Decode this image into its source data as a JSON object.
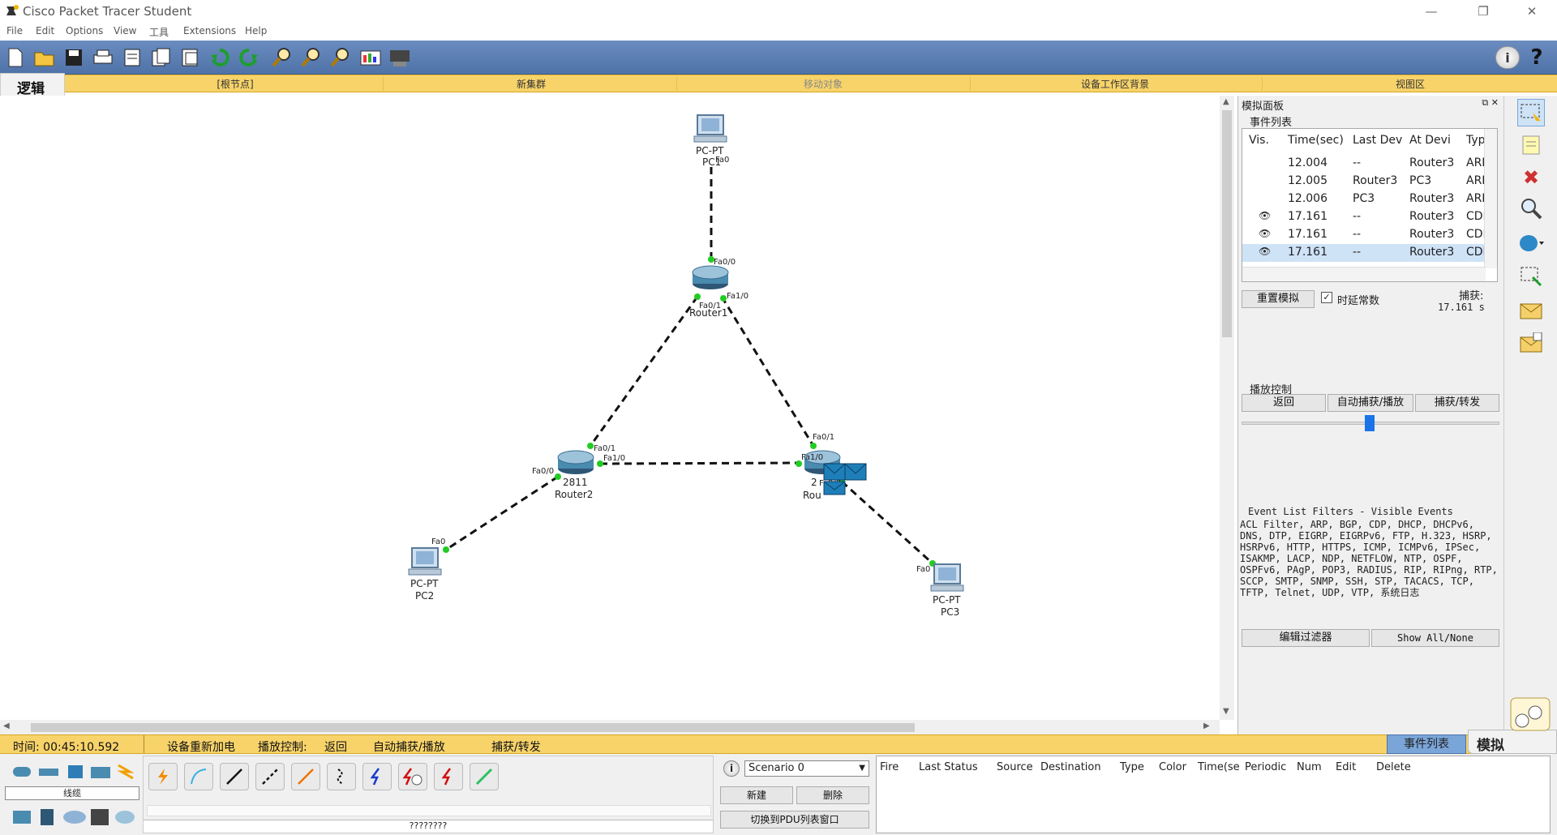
{
  "window": {
    "title": "Cisco Packet Tracer Student"
  },
  "menu": [
    "File",
    "Edit",
    "Options",
    "View",
    "工具",
    "Extensions",
    "Help"
  ],
  "workspace_bar": {
    "mode": "逻辑",
    "root": "[根节点]",
    "new_cluster": "新集群",
    "move_object": "移动对象",
    "set_tiled_background": "设备工作区背景",
    "viewport": "视图区"
  },
  "topology": {
    "devices": [
      {
        "id": "pc1",
        "model": "PC-PT",
        "name": "PC1"
      },
      {
        "id": "router1",
        "model": "",
        "name": "Router1"
      },
      {
        "id": "router2",
        "model": "2811",
        "name": "Router2"
      },
      {
        "id": "router3",
        "model": "2",
        "name": "Rou"
      },
      {
        "id": "pc2",
        "model": "PC-PT",
        "name": "PC2"
      },
      {
        "id": "pc3",
        "model": "PC-PT",
        "name": "PC3"
      }
    ],
    "ports": {
      "pc1_fa0": "Fa0",
      "r1_fa00": "Fa0/0",
      "r1_fa01": "Fa0/1",
      "r1_fa10": "Fa1/0",
      "r2_fa01": "Fa0/1",
      "r2_fa10": "Fa1/0",
      "r2_fa00": "Fa0/0",
      "r3_fa01": "Fa0/1",
      "r3_fa10": "Fa1/0",
      "r3_fa00": "Fa0/0",
      "pc2_fa0": "Fa0",
      "pc3_fa0": "Fa0"
    }
  },
  "sim_panel": {
    "title": "模拟面板",
    "event_list_title": "事件列表",
    "columns": [
      "Vis.",
      "Time(sec)",
      "Last Dev",
      "At Devi",
      "Typ"
    ],
    "events": [
      {
        "vis": false,
        "time": "12.004",
        "last": "--",
        "at": "Router3",
        "type": "ARI"
      },
      {
        "vis": false,
        "time": "12.005",
        "last": "Router3",
        "at": "PC3",
        "type": "ARI"
      },
      {
        "vis": false,
        "time": "12.006",
        "last": "PC3",
        "at": "Router3",
        "type": "ARI"
      },
      {
        "vis": true,
        "time": "17.161",
        "last": "--",
        "at": "Router3",
        "type": "CDI"
      },
      {
        "vis": true,
        "time": "17.161",
        "last": "--",
        "at": "Router3",
        "type": "CDI"
      },
      {
        "vis": true,
        "time": "17.161",
        "last": "--",
        "at": "Router3",
        "type": "CDI",
        "selected": true
      }
    ],
    "reset_sim": "重置模拟",
    "constant_delay": "时延常数",
    "constant_delay_checked": true,
    "captured_label": "捕获:",
    "captured_value": "17.161 s",
    "play_controls_title": "播放控制",
    "back": "返回",
    "auto_capture": "自动捕获/播放",
    "capture_forward": "捕获/转发",
    "filters_title": "Event List Filters - Visible Events",
    "filters_text": "ACL Filter, ARP, BGP, CDP, DHCP, DHCPv6, DNS, DTP, EIGRP, EIGRPv6, FTP, H.323, HSRP, HSRPv6, HTTP, HTTPS, ICMP, ICMPv6, IPSec, ISAKMP, LACP, NDP, NETFLOW, NTP, OSPF, OSPFv6, PAgP, POP3, RADIUS, RIP, RIPng, RTP, SCCP, SMTP, SNMP, SSH, STP, TACACS, TCP, TFTP, Telnet, UDP, VTP, 系统日志",
    "edit_filters": "编辑过滤器",
    "show_all": "Show All/None"
  },
  "status_bar": {
    "time": "时间: 00:45:10.592",
    "power_cycle": "设备重新加电",
    "play_control_label": "播放控制:",
    "back": "返回",
    "auto_capture": "自动捕获/播放",
    "capture_forward": "捕获/转发",
    "event_list_tab": "事件列表",
    "sim_tab": "模拟"
  },
  "bottom": {
    "device_category_label": "线缆",
    "cable_caption": "????????",
    "scenario_value": "Scenario 0",
    "new_btn": "新建",
    "delete_btn": "删除",
    "toggle_pdu": "切换到PDU列表窗口",
    "pdu_columns": [
      "Fire",
      "Last Status",
      "Source",
      "Destination",
      "Type",
      "Color",
      "Time(se",
      "Periodic",
      "Num",
      "Edit",
      "Delete"
    ]
  },
  "colors": {
    "accent": "#4f72a8",
    "workspace_yellow": "#f7d36a",
    "link_up": "#22cc22"
  }
}
